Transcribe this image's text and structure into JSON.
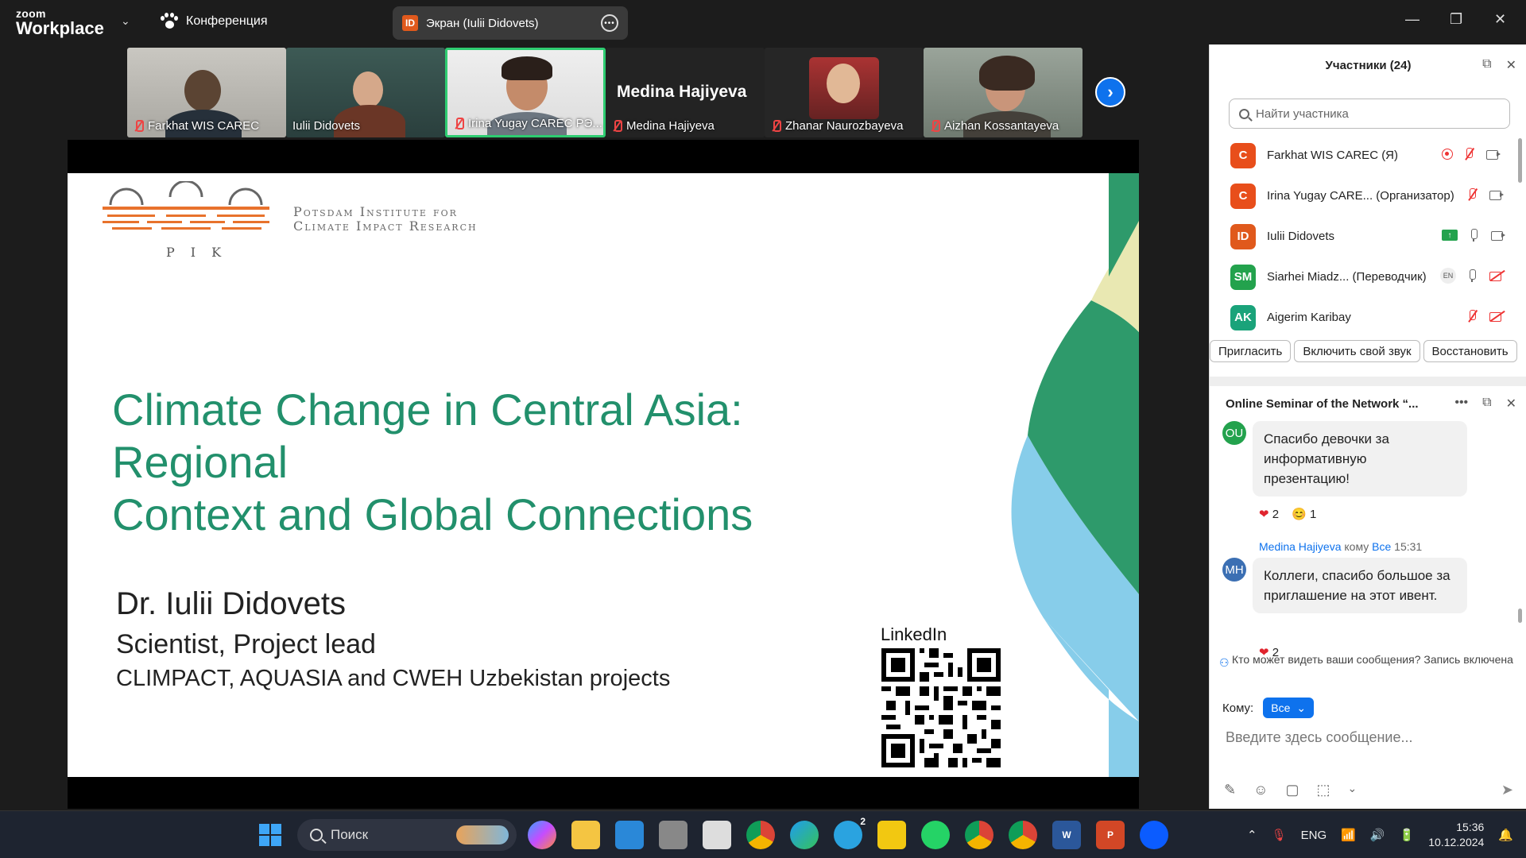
{
  "app": {
    "logo_small": "zoom",
    "logo_big": "Workplace",
    "conference_label": "Конференция",
    "screen_badge": "ID",
    "screen_share_label": "Экран (Iulii Didovets)"
  },
  "thumbnails": [
    {
      "name": "Farkhat WIS CAREC",
      "muted": true
    },
    {
      "name": "Iulii Didovets",
      "muted": false
    },
    {
      "name": "Irina Yugay CAREC РЭ...",
      "muted": true,
      "active_speaker": true
    },
    {
      "name": "Medina Hajiyeva",
      "muted": true,
      "no_video_label": "Medina Hajiyeva"
    },
    {
      "name": "Zhanar Naurozbayeva",
      "muted": true
    },
    {
      "name": "Aizhan Kossantayeva",
      "muted": true
    }
  ],
  "slide": {
    "org_line1": "Potsdam Institute for",
    "org_line2": "Climate Impact Research",
    "org_acronym": "PIK",
    "title_line1": "Climate Change in Central Asia: Regional",
    "title_line2": "Context and Global Connections",
    "presenter": "Dr. Iulii Didovets",
    "role": "Scientist, Project lead",
    "projects": "CLIMPACT, AQUASIA and CWEH Uzbekistan projects",
    "linkedin_label": "LinkedIn"
  },
  "participants_panel": {
    "title": "Участники (24)",
    "search_placeholder": "Найти участника",
    "participants": [
      {
        "initials": "C",
        "name": "Farkhat WIS CAREC (Я)",
        "color": "#e84e1b"
      },
      {
        "initials": "C",
        "name": "Irina Yugay CARE... (Организатор)",
        "color": "#e84e1b"
      },
      {
        "initials": "ID",
        "name": "Iulii Didovets",
        "color": "#e0591c"
      },
      {
        "initials": "SM",
        "name": "Siarhei Miadz... (Переводчик)",
        "color": "#23a24d",
        "lang": "EN"
      },
      {
        "initials": "AK",
        "name": "Aigerim Karibay",
        "color": "#1aa37a"
      }
    ],
    "buttons": [
      "Пригласить",
      "Включить свой звук",
      "Восстановить"
    ]
  },
  "chat": {
    "title": "Online Seminar of the Network “...",
    "messages": [
      {
        "avatar": "OU",
        "avatar_color": "#23a24d",
        "text": "Спасибо девочки за информативную презентацию!",
        "reactions": [
          {
            "emoji": "❤",
            "count": "2"
          },
          {
            "emoji": "😊",
            "count": "1"
          }
        ]
      },
      {
        "avatar": "MH",
        "avatar_color": "#3b6fb3",
        "sender": "Medina Hajiyeva",
        "to_word": "кому",
        "recipient": "Все",
        "time": "15:31",
        "text": "Коллеги, спасибо большое за приглашение на этот ивент.",
        "reactions": [
          {
            "emoji": "❤",
            "count": "2"
          }
        ]
      }
    ],
    "visibility_hint": "Кто может видеть ваши сообщения? Запись включена",
    "to_label": "Кому:",
    "to_value": "Все",
    "composer_placeholder": "Введите здесь сообщение..."
  },
  "taskbar": {
    "search_label": "Поиск",
    "language": "ENG",
    "time": "15:36",
    "date": "10.12.2024",
    "telegram_badge": "2"
  },
  "colors": {
    "accent": "#0e72ed",
    "slide_title": "#22906c",
    "muted_red": "#e33333"
  }
}
